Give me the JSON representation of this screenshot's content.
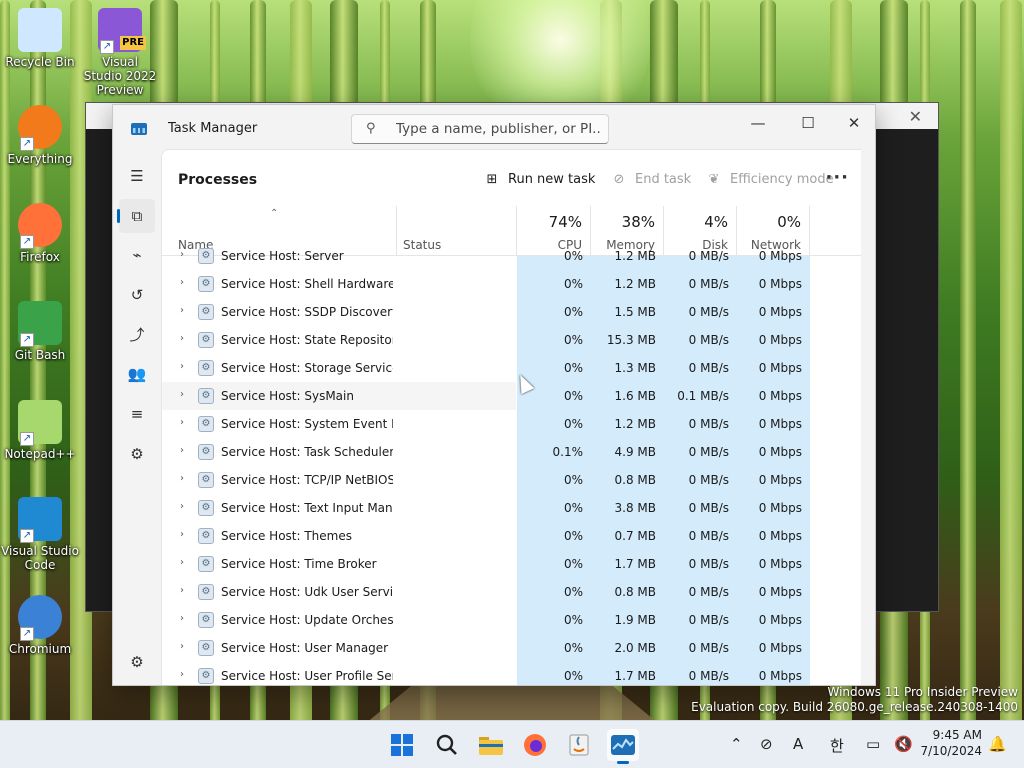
{
  "desktop": {
    "icons": [
      {
        "label": "Recycle Bin",
        "icon": "recycle-bin-icon"
      },
      {
        "label": "Visual Studio 2022 Preview",
        "icon": "visual-studio-preview-icon",
        "badge": "PRE"
      },
      {
        "label": "Everything",
        "icon": "everything-search-icon"
      },
      {
        "label": "Firefox",
        "icon": "firefox-icon"
      },
      {
        "label": "Git Bash",
        "icon": "git-bash-icon"
      },
      {
        "label": "Notepad++",
        "icon": "notepadpp-icon"
      },
      {
        "label": "Visual Studio Code",
        "icon": "vscode-icon"
      },
      {
        "label": "Chromium",
        "icon": "chromium-icon"
      }
    ]
  },
  "window": {
    "title": "Task Manager",
    "search_placeholder": "Type a name, publisher, or PI...",
    "controls": {
      "minimize": "—",
      "maximize": "☐",
      "close": "✕"
    }
  },
  "nav": {
    "items": [
      {
        "name": "hamburger-menu-icon",
        "glyph": "☰"
      },
      {
        "name": "processes-icon",
        "glyph": "⧉"
      },
      {
        "name": "performance-icon",
        "glyph": "⌁"
      },
      {
        "name": "app-history-icon",
        "glyph": "↺"
      },
      {
        "name": "startup-apps-icon",
        "glyph": "⤴"
      },
      {
        "name": "users-icon",
        "glyph": "👥"
      },
      {
        "name": "details-icon",
        "glyph": "≡"
      },
      {
        "name": "services-icon",
        "glyph": "⚙"
      },
      {
        "name": "settings-icon",
        "glyph": "⚙"
      }
    ]
  },
  "toolbar": {
    "heading": "Processes",
    "run_new_task": "Run new task",
    "end_task": "End task",
    "efficiency_mode": "Efficiency mode",
    "more": "···"
  },
  "columns": {
    "name": "Name",
    "status": "Status",
    "cpu": {
      "pct": "74%",
      "label": "CPU"
    },
    "memory": {
      "pct": "38%",
      "label": "Memory"
    },
    "disk": {
      "pct": "4%",
      "label": "Disk"
    },
    "network": {
      "pct": "0%",
      "label": "Network"
    }
  },
  "processes": [
    {
      "name": "Service Host: Server",
      "cpu": "0%",
      "memory": "1.2 MB",
      "disk": "0 MB/s",
      "network": "0 Mbps"
    },
    {
      "name": "Service Host: Shell Hardware ...",
      "cpu": "0%",
      "memory": "1.2 MB",
      "disk": "0 MB/s",
      "network": "0 Mbps"
    },
    {
      "name": "Service Host: SSDP Discovery",
      "cpu": "0%",
      "memory": "1.5 MB",
      "disk": "0 MB/s",
      "network": "0 Mbps"
    },
    {
      "name": "Service Host: State Repository ...",
      "cpu": "0%",
      "memory": "15.3 MB",
      "disk": "0 MB/s",
      "network": "0 Mbps"
    },
    {
      "name": "Service Host: Storage Service",
      "cpu": "0%",
      "memory": "1.3 MB",
      "disk": "0 MB/s",
      "network": "0 Mbps"
    },
    {
      "name": "Service Host: SysMain",
      "cpu": "0%",
      "memory": "1.6 MB",
      "disk": "0.1 MB/s",
      "network": "0 Mbps"
    },
    {
      "name": "Service Host: System Event No...",
      "cpu": "0%",
      "memory": "1.2 MB",
      "disk": "0 MB/s",
      "network": "0 Mbps"
    },
    {
      "name": "Service Host: Task Scheduler",
      "cpu": "0.1%",
      "memory": "4.9 MB",
      "disk": "0 MB/s",
      "network": "0 Mbps"
    },
    {
      "name": "Service Host: TCP/IP NetBIOS ...",
      "cpu": "0%",
      "memory": "0.8 MB",
      "disk": "0 MB/s",
      "network": "0 Mbps"
    },
    {
      "name": "Service Host: Text Input Mana...",
      "cpu": "0%",
      "memory": "3.8 MB",
      "disk": "0 MB/s",
      "network": "0 Mbps"
    },
    {
      "name": "Service Host: Themes",
      "cpu": "0%",
      "memory": "0.7 MB",
      "disk": "0 MB/s",
      "network": "0 Mbps"
    },
    {
      "name": "Service Host: Time Broker",
      "cpu": "0%",
      "memory": "1.7 MB",
      "disk": "0 MB/s",
      "network": "0 Mbps"
    },
    {
      "name": "Service Host: Udk User Service...",
      "cpu": "0%",
      "memory": "0.8 MB",
      "disk": "0 MB/s",
      "network": "0 Mbps"
    },
    {
      "name": "Service Host: Update Orchestr...",
      "cpu": "0%",
      "memory": "1.9 MB",
      "disk": "0 MB/s",
      "network": "0 Mbps"
    },
    {
      "name": "Service Host: User Manager",
      "cpu": "0%",
      "memory": "2.0 MB",
      "disk": "0 MB/s",
      "network": "0 Mbps"
    },
    {
      "name": "Service Host: User Profile Servi...",
      "cpu": "0%",
      "memory": "1.7 MB",
      "disk": "0 MB/s",
      "network": "0 Mbps"
    }
  ],
  "watermark": {
    "line1": "Windows 11 Pro Insider Preview",
    "line2": "Evaluation copy. Build 26080.ge_release.240308-1400"
  },
  "taskbar": {
    "apps": [
      "start-icon",
      "search-icon",
      "file-explorer-icon",
      "firefox-icon",
      "java-app-icon",
      "task-manager-icon"
    ],
    "tray": {
      "ime": "A",
      "ime_ko": "한"
    },
    "time": "9:45 AM",
    "date": "7/10/2024"
  },
  "colors": {
    "accent": "#0067c0",
    "heat": "#d3ebfb"
  }
}
